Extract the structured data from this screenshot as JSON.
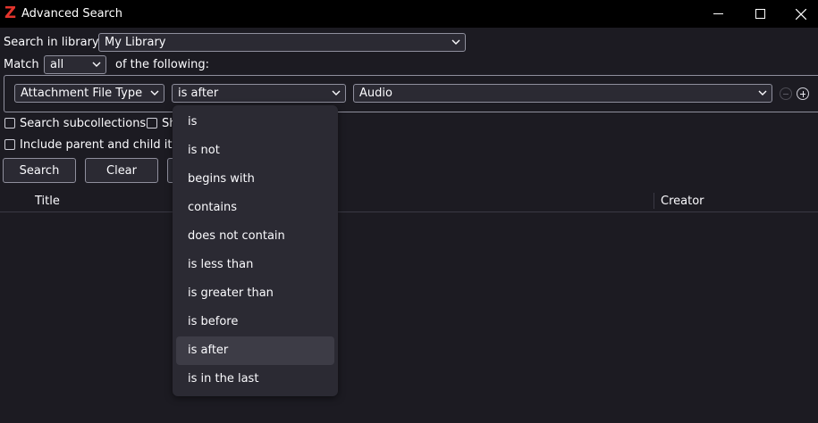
{
  "window": {
    "logo": "Z",
    "title": "Advanced Search",
    "controls": [
      "minimize-icon",
      "maximize-icon",
      "close-icon"
    ]
  },
  "search_in": {
    "label": "Search in library:",
    "value": "My Library"
  },
  "match": {
    "label": "Match",
    "value": "all",
    "suffix": "of the following:"
  },
  "condition": {
    "field": "Attachment File Type",
    "operator": "is after",
    "value": "Audio"
  },
  "options": {
    "search_subcollections": "Search subcollections",
    "show_truncated": "Sh",
    "include_parent_child": "Include parent and child item"
  },
  "buttons": {
    "search": "Search",
    "clear": "Clear"
  },
  "results": {
    "columns": [
      "Title",
      "Creator"
    ]
  },
  "operator_menu": {
    "items": [
      "is",
      "is not",
      "begins with",
      "contains",
      "does not contain",
      "is less than",
      "is greater than",
      "is before",
      "is after",
      "is in the last"
    ],
    "selected": "is after"
  },
  "colors": {
    "accent_logo": "#e2342c",
    "background": "#1c1b22",
    "control": "#2b2a33"
  }
}
